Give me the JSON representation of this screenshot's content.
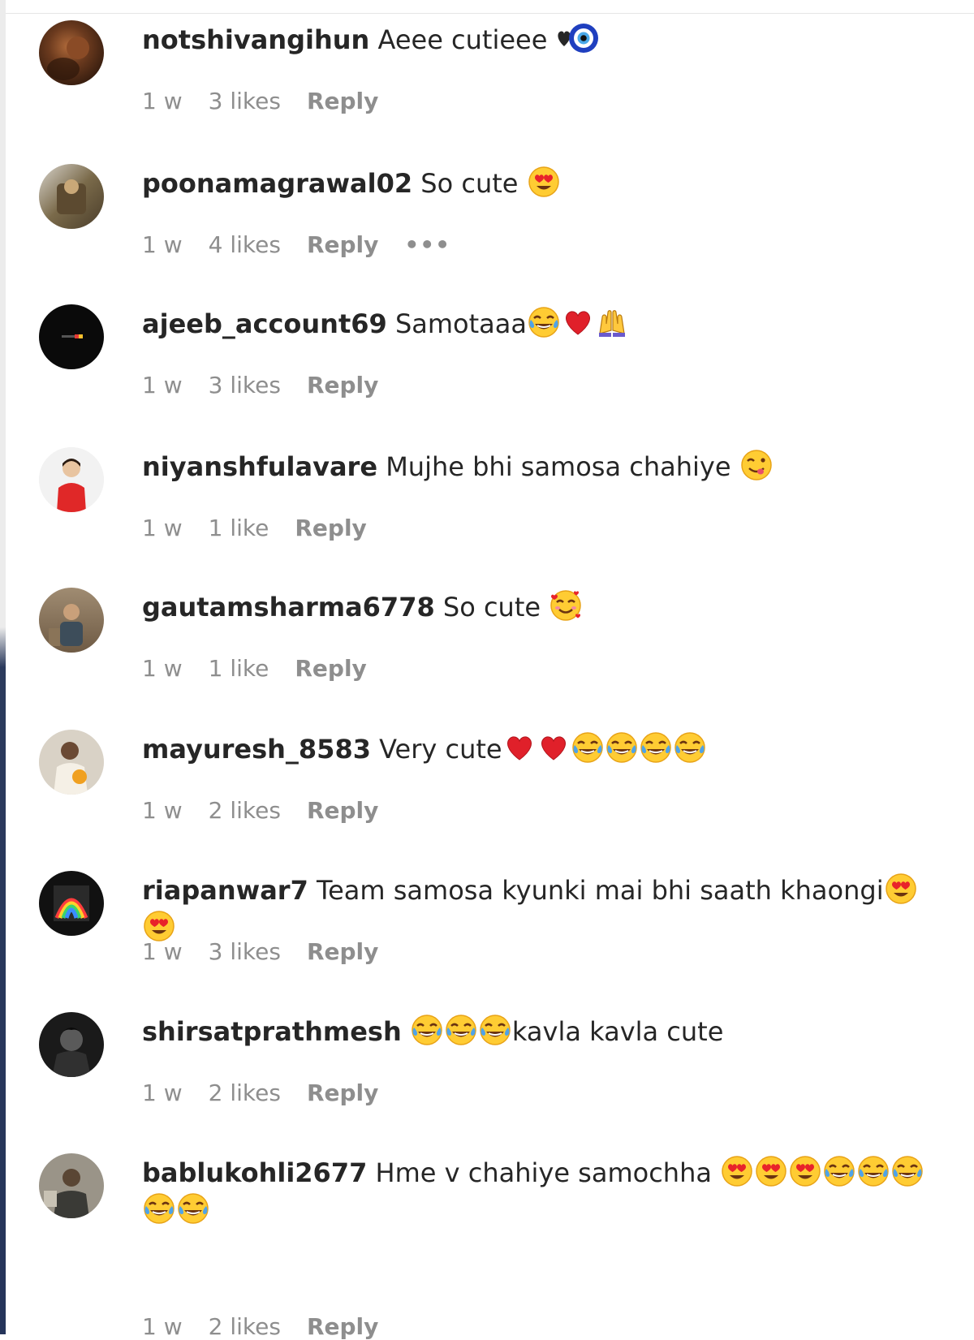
{
  "comments": [
    {
      "username": "notshivangihun",
      "text": "Aeee cutieee",
      "emoji_after": [
        "black-heart-icon",
        "nazar-amulet-icon"
      ],
      "time": "1 w",
      "likes": "3 likes",
      "reply_label": "Reply"
    },
    {
      "username": "poonamagrawal02",
      "text": "So cute",
      "emoji_after": [
        "heart-eyes-emoji"
      ],
      "time": "1 w",
      "likes": "4 likes",
      "reply_label": "Reply",
      "more_label": "•••"
    },
    {
      "username": "ajeeb_account69",
      "text": "Samotaaa",
      "emoji_after": [
        "tears-of-joy-emoji",
        "red-heart-emoji",
        "raising-hands-emoji"
      ],
      "time": "1 w",
      "likes": "3 likes",
      "reply_label": "Reply"
    },
    {
      "username": "niyanshfulavare",
      "text": "Mujhe bhi samosa chahiye",
      "emoji_after": [
        "yum-emoji"
      ],
      "time": "1 w",
      "likes": "1 like",
      "reply_label": "Reply"
    },
    {
      "username": "gautamsharma6778",
      "text": "So cute",
      "emoji_after": [
        "smiling-hearts-emoji"
      ],
      "time": "1 w",
      "likes": "1 like",
      "reply_label": "Reply"
    },
    {
      "username": "mayuresh_8583",
      "text": "Very cute",
      "emoji_after": [
        "red-heart-emoji",
        "red-heart-emoji",
        "tears-of-joy-emoji",
        "tears-of-joy-emoji",
        "tears-of-joy-emoji",
        "tears-of-joy-emoji"
      ],
      "time": "1 w",
      "likes": "2 likes",
      "reply_label": "Reply"
    },
    {
      "username": "riapanwar7",
      "text": "Team samosa kyunki mai bhi saath khaongi",
      "emoji_after": [
        "heart-eyes-emoji",
        "heart-eyes-emoji"
      ],
      "time": "1 w",
      "likes": "3 likes",
      "reply_label": "Reply"
    },
    {
      "username": "shirsatprathmesh",
      "text": "kavla kavla cute",
      "emoji_before": [
        "tears-of-joy-emoji",
        "tears-of-joy-emoji",
        "tears-of-joy-emoji"
      ],
      "time": "1 w",
      "likes": "2 likes",
      "reply_label": "Reply"
    },
    {
      "username": "bablukohli2677",
      "text": "Hme v chahiye samochha",
      "emoji_after": [
        "heart-eyes-emoji",
        "heart-eyes-emoji",
        "heart-eyes-emoji",
        "tears-of-joy-emoji",
        "tears-of-joy-emoji",
        "tears-of-joy-emoji",
        "tears-of-joy-emoji",
        "tears-of-joy-emoji"
      ],
      "time": "1 w",
      "likes": "2 likes",
      "reply_label": "Reply"
    }
  ],
  "colors": {
    "username": "#262626",
    "meta": "#8e8e8e",
    "divider": "#e6e6e6"
  }
}
